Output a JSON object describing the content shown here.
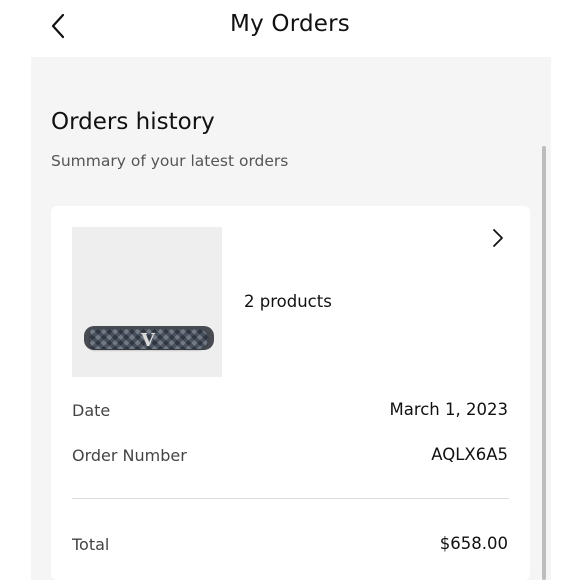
{
  "header": {
    "title": "My Orders",
    "back_icon": "chevron-left-icon"
  },
  "section": {
    "title": "Orders history",
    "subtitle": "Summary of your latest orders"
  },
  "order": {
    "product_count_label": "2 products",
    "image": "belt-product-image",
    "open_icon": "chevron-right-icon",
    "date_label": "Date",
    "date_value": "March 1, 2023",
    "number_label": "Order Number",
    "number_value": "AQLX6A5",
    "total_label": "Total",
    "total_value": "$658.00"
  },
  "colors": {
    "page_background": "#f5f5f5",
    "card_background": "#ffffff",
    "text_primary": "#111111",
    "text_secondary": "#555555"
  }
}
